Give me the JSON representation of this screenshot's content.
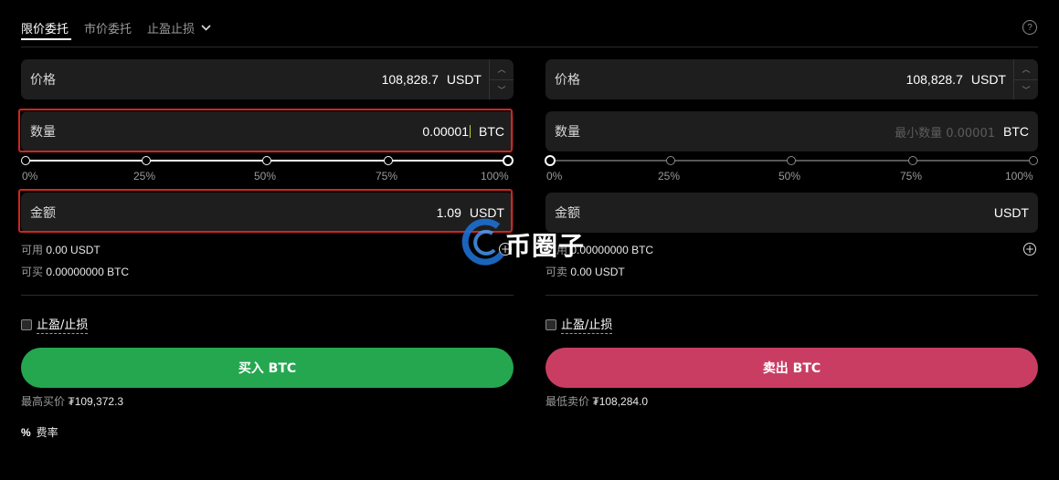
{
  "tabs": {
    "limit": "限价委托",
    "market": "市价委托",
    "tpsl": "止盈止损"
  },
  "buy": {
    "price_label": "价格",
    "price_value": "108,828.7",
    "price_unit": "USDT",
    "qty_label": "数量",
    "qty_value": "0.00001",
    "qty_unit": "BTC",
    "slider_percent": 100,
    "ticks": [
      "0%",
      "25%",
      "50%",
      "75%",
      "100%"
    ],
    "amount_label": "金额",
    "amount_value": "1.09",
    "amount_unit": "USDT",
    "avail_label": "可用",
    "avail_value": "0.00 USDT",
    "canbuy_label": "可买",
    "canbuy_value": "0.00000000 BTC",
    "tpsl_label": "止盈/止损",
    "button_label": "买入 BTC",
    "best_label": "最高买价",
    "best_value": "₮109,372.3"
  },
  "sell": {
    "price_label": "价格",
    "price_value": "108,828.7",
    "price_unit": "USDT",
    "qty_label": "数量",
    "qty_placeholder": "最小数量 0.00001",
    "qty_unit": "BTC",
    "slider_percent": 0,
    "ticks": [
      "0%",
      "25%",
      "50%",
      "75%",
      "100%"
    ],
    "amount_label": "金额",
    "amount_unit": "USDT",
    "avail_label": "可用",
    "avail_value": "0.00000000 BTC",
    "cansell_label": "可卖",
    "cansell_value": "0.00 USDT",
    "tpsl_label": "止盈/止损",
    "button_label": "卖出 BTC",
    "best_label": "最低卖价",
    "best_value": "₮108,284.0"
  },
  "fee": {
    "icon": "%",
    "label": "费率"
  },
  "watermark": {
    "text": "币圈子"
  },
  "colors": {
    "buy": "#25a750",
    "sell": "#c93d63",
    "highlight": "#d0261e"
  }
}
